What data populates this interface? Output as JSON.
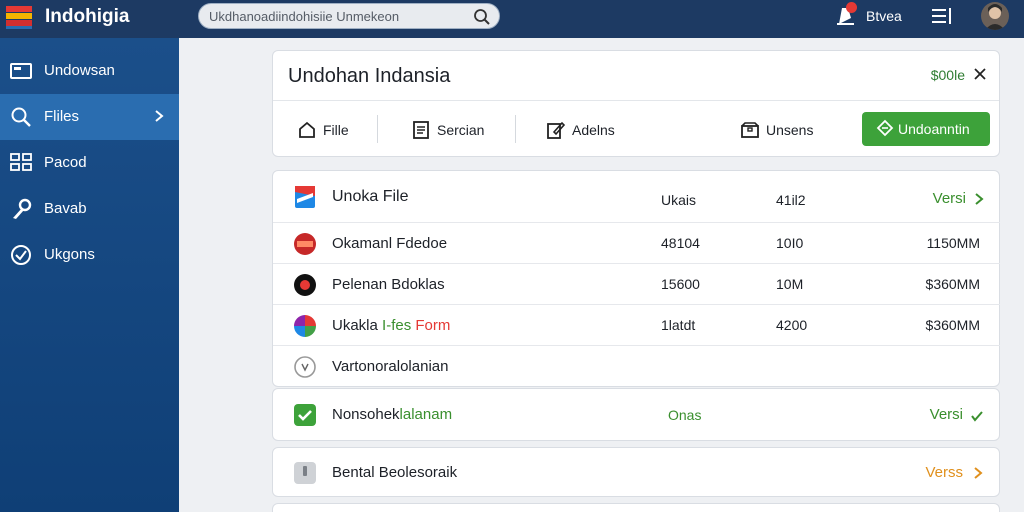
{
  "header": {
    "brand": "Indohigia",
    "search_value": "Ukdhanoadiindohisiie  Unmekeon",
    "user_name": "Btvea",
    "colors": {
      "topbar": "#1d3a63",
      "accent": "#3da23a",
      "notification": "#e53935"
    }
  },
  "sidebar": {
    "items": [
      {
        "label": "Undowsan",
        "icon": "folder-icon"
      },
      {
        "label": "Fliles",
        "icon": "search-icon",
        "active": true
      },
      {
        "label": "Pacod",
        "icon": "grid-icon"
      },
      {
        "label": "Bavab",
        "icon": "wrench-icon"
      },
      {
        "label": "Ukgons",
        "icon": "check-circle-icon"
      }
    ]
  },
  "panel": {
    "title": "Undohan Indansia",
    "amount": "$00le",
    "toolbar": {
      "file": "Fille",
      "search": "Sercian",
      "details": "Adelns",
      "unsens": "Unsens",
      "primary": "Undoanntin"
    }
  },
  "files": {
    "head": {
      "name": "Unoka File",
      "col1": "Ukais",
      "col2": "41il2",
      "status": "Versi"
    },
    "rows": [
      {
        "name": "Okamanl  Fdedoe",
        "col1": "48104",
        "col2": "10I0",
        "col3": "1150MM"
      },
      {
        "name": "Pelenan  Bdoklas",
        "col1": "15600",
        "col2": "10M",
        "col3": "$360MM"
      },
      {
        "name_a": "Ukakla",
        "name_b": "I-fes",
        "name_c": "Form",
        "col1": "1latdt",
        "col2": "4200",
        "col3": "$360MM"
      },
      {
        "name": "Vartonoralolanian"
      }
    ]
  },
  "confirmed": {
    "name_a": "Nonsohek",
    "name_b": "lalanam",
    "status": "Onas",
    "version": "Versi"
  },
  "pending": {
    "name": "Bental  Beolesoraik",
    "version": "Verss"
  }
}
